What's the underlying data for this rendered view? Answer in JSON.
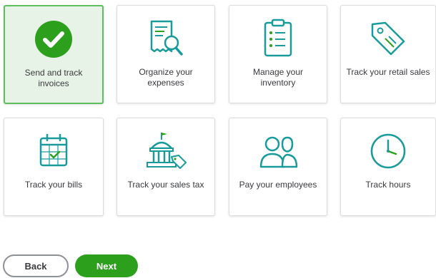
{
  "tiles": [
    {
      "label": "Send and track invoices",
      "icon": "checkmark-circle-icon",
      "selected": true
    },
    {
      "label": "Organize your expenses",
      "icon": "receipt-search-icon",
      "selected": false
    },
    {
      "label": "Manage your inventory",
      "icon": "clipboard-list-icon",
      "selected": false
    },
    {
      "label": "Track your retail sales",
      "icon": "price-tag-icon",
      "selected": false
    },
    {
      "label": "Track your bills",
      "icon": "calendar-check-icon",
      "selected": false
    },
    {
      "label": "Track your sales tax",
      "icon": "government-building-tag-icon",
      "selected": false
    },
    {
      "label": "Pay your employees",
      "icon": "people-icon",
      "selected": false
    },
    {
      "label": "Track hours",
      "icon": "clock-icon",
      "selected": false
    }
  ],
  "buttons": {
    "back_label": "Back",
    "next_label": "Next"
  },
  "colors": {
    "accent": "#2ca01c",
    "teal": "#1a9b9b",
    "selected_bg": "#e8f3e8",
    "selected_border": "#5cbf5c"
  }
}
